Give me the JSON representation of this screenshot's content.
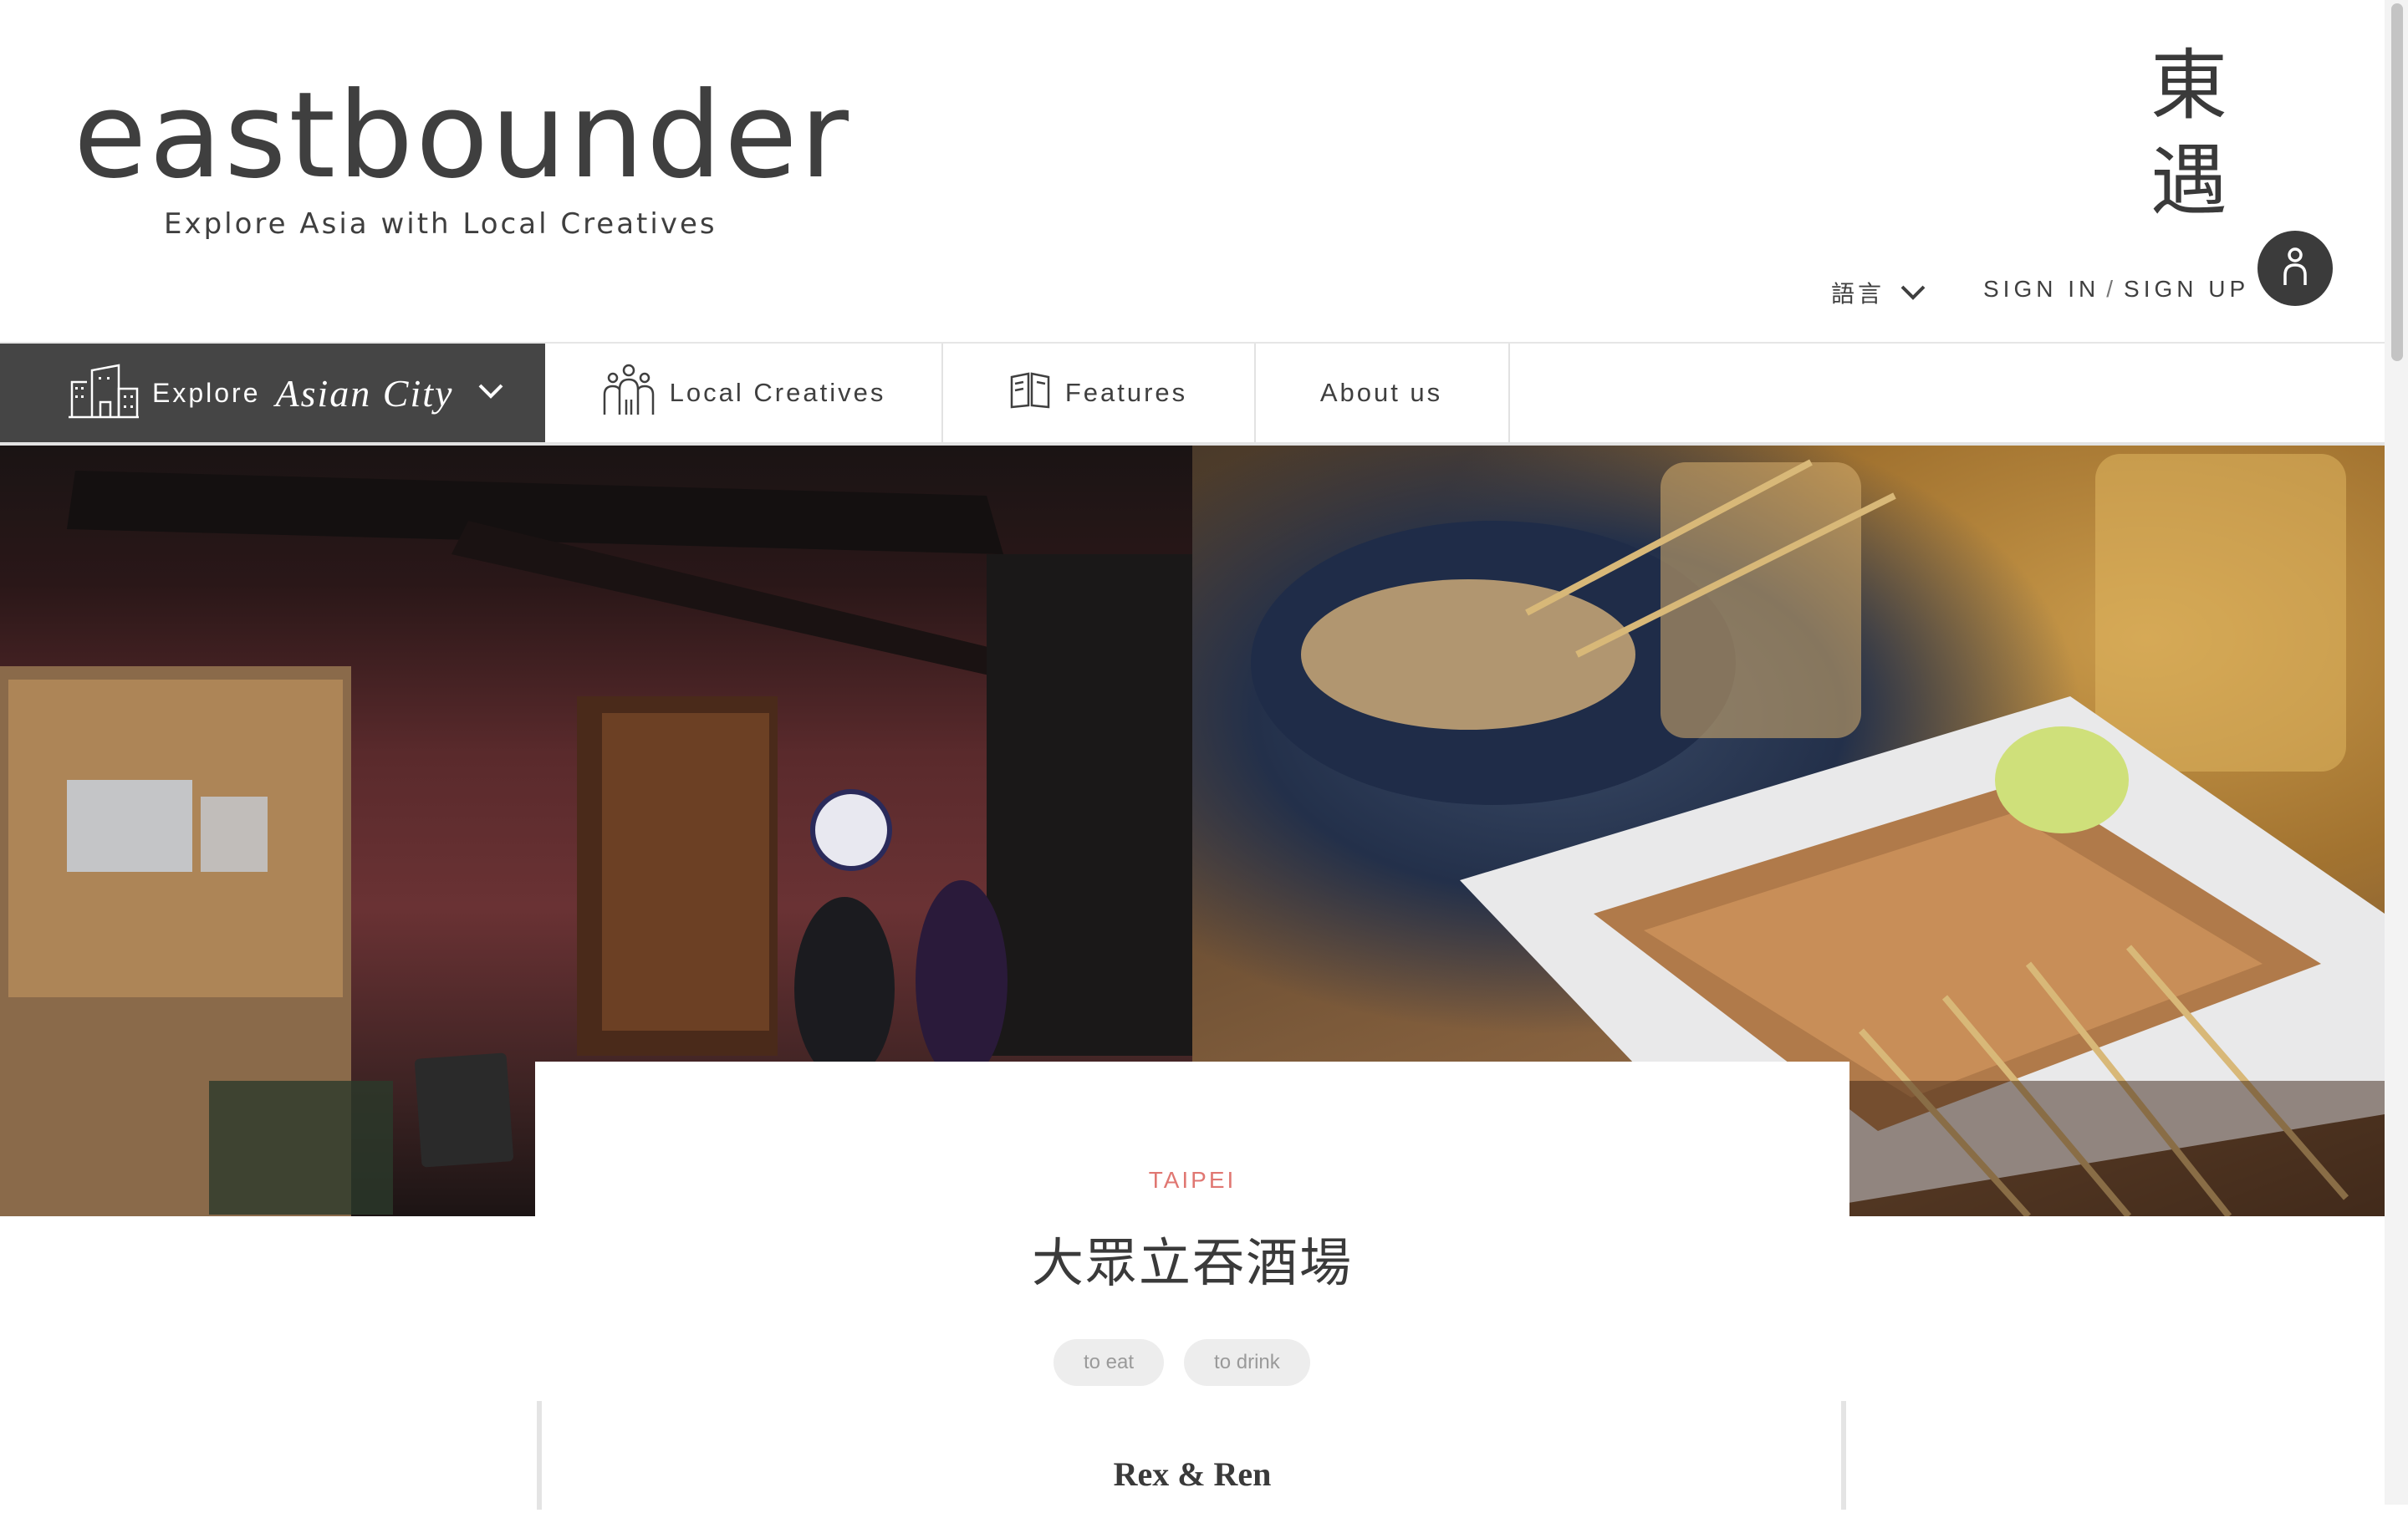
{
  "header": {
    "logo_word": "eastbounder",
    "tagline": "Explore Asia with Local Creatives",
    "brand_cjk_1": "東",
    "brand_cjk_2": "遇",
    "language_label": "語言",
    "sign_in": "SIGN IN",
    "separator": "/",
    "sign_up": "SIGN UP"
  },
  "nav": {
    "explore_label": "Explore",
    "city_label": "Asian City",
    "local_creatives": "Local Creatives",
    "features": "Features",
    "about": "About us"
  },
  "article": {
    "city": "TAIPEI",
    "title": "大眾立吞酒場",
    "tags": [
      "to eat",
      "to drink"
    ],
    "author": "Rex & Ren"
  },
  "colors": {
    "accent_city": "#e07772",
    "nav_dark": "#454545",
    "text": "#3f3f3f"
  },
  "icons": [
    "city-icon",
    "chevron-down-icon",
    "people-icon",
    "book-icon",
    "user-icon"
  ]
}
